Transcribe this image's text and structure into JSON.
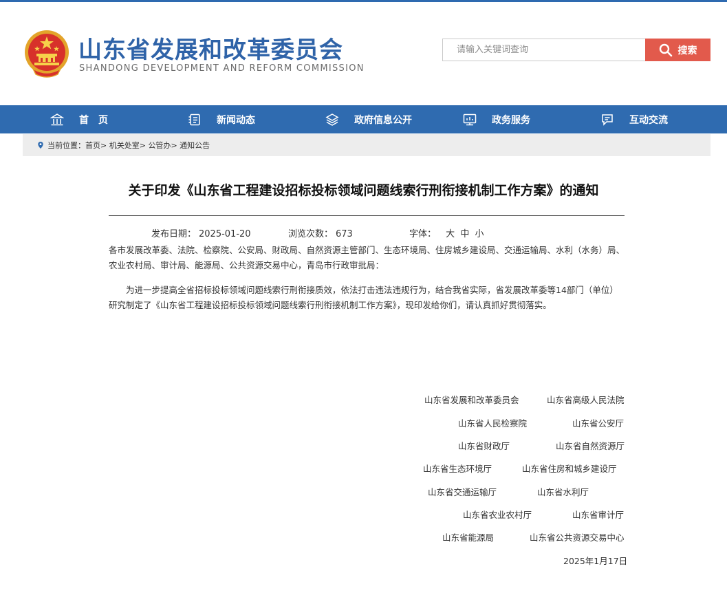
{
  "header": {
    "site_title": "山东省发展和改革委员会",
    "site_subtitle": "SHANDONG DEVELOPMENT AND REFORM COMMISSION",
    "emblem_icon": "national-emblem-icon"
  },
  "search": {
    "placeholder": "请输入关键词查询",
    "button_label": "搜索"
  },
  "nav": {
    "items": [
      {
        "label": "首　页",
        "icon": "home-icon"
      },
      {
        "label": "新闻动态",
        "icon": "news-icon"
      },
      {
        "label": "政府信息公开",
        "icon": "layers-icon"
      },
      {
        "label": "政务服务",
        "icon": "monitor-chart-icon"
      },
      {
        "label": "互动交流",
        "icon": "chat-icon"
      }
    ]
  },
  "breadcrumb": {
    "prefix": "当前位置：",
    "items": [
      "首页",
      "机关处室",
      "公管办",
      "通知公告"
    ],
    "separator": ">"
  },
  "article": {
    "title": "关于印发《山东省工程建设招标投标领域问题线索行刑衔接机制工作方案》的通知",
    "publish_label": "发布日期：",
    "publish_date": "2025-01-20",
    "views_label": "浏览次数：",
    "views": "673",
    "font_label": "字体：",
    "font_sizes": [
      "大",
      "中",
      "小"
    ],
    "recipients": "各市发展改革委、法院、检察院、公安局、财政局、自然资源主管部门、生态环境局、住房城乡建设局、交通运输局、水利（水务）局、农业农村局、审计局、能源局、公共资源交易中心，青岛市行政审批局：",
    "paragraph": "为进一步提高全省招标投标领域问题线索行刑衔接质效，依法打击违法违规行为，结合我省实际，省发展改革委等14部门（单位）研究制定了《山东省工程建设招标投标领域问题线索行刑衔接机制工作方案》，现印发给你们，请认真抓好贯彻落实。",
    "signatories": [
      "山东省发展和改革委员会",
      "山东省高级人民法院",
      "山东省人民检察院",
      "山东省公安厅",
      "山东省财政厅",
      "山东省自然资源厅",
      "山东省生态环境厅",
      "山东省住房和城乡建设厅",
      "山东省交通运输厅",
      "山东省水利厅",
      "山东省农业农村厅",
      "山东省审计厅",
      "山东省能源局",
      "山东省公共资源交易中心"
    ],
    "date": "2025年1月17日"
  },
  "colors": {
    "brand_blue": "#2f6bb0",
    "search_red": "#e25a4c",
    "breadcrumb_bg": "#ededed"
  }
}
